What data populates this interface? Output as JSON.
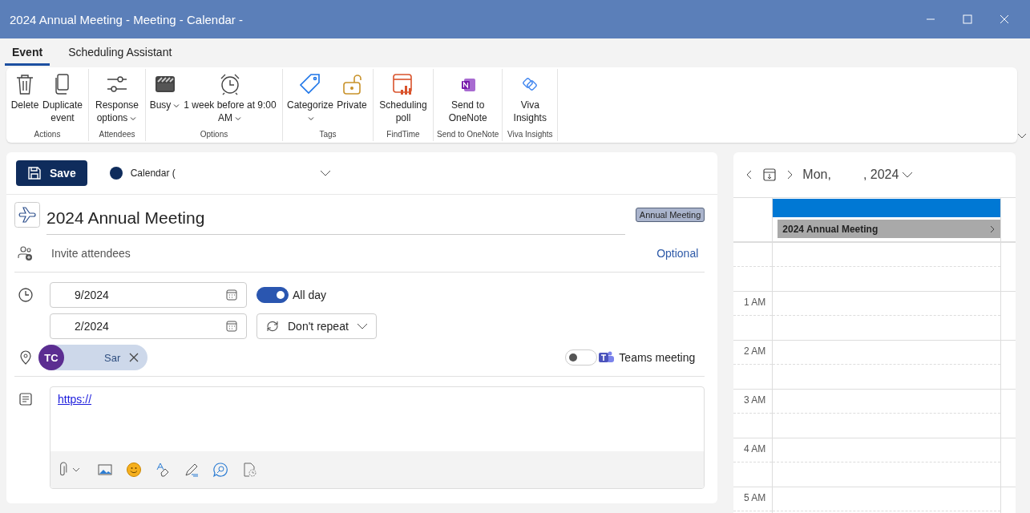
{
  "window": {
    "title": "2024 Annual Meeting - Meeting - Calendar -"
  },
  "tabs": [
    {
      "label": "Event",
      "selected": true
    },
    {
      "label": "Scheduling Assistant",
      "selected": false
    }
  ],
  "ribbon": {
    "groups": [
      {
        "name": "Actions",
        "buttons": [
          {
            "label": "Delete",
            "dropdown": false
          },
          {
            "label": "Duplicate event",
            "dropdown": false
          }
        ]
      },
      {
        "name": "Attendees",
        "buttons": [
          {
            "label": "Response options",
            "dropdown": true
          }
        ]
      },
      {
        "name": "Options",
        "buttons": [
          {
            "label": "Busy",
            "dropdown": true
          },
          {
            "label": "1 week before at 9:00 AM",
            "dropdown": true
          }
        ]
      },
      {
        "name": "Tags",
        "buttons": [
          {
            "label": "Categorize",
            "dropdown": true
          },
          {
            "label": "Private",
            "dropdown": false
          }
        ]
      },
      {
        "name": "FindTime",
        "buttons": [
          {
            "label": "Scheduling poll",
            "dropdown": false
          }
        ]
      },
      {
        "name": "Send to OneNote",
        "buttons": [
          {
            "label": "Send to OneNote",
            "dropdown": false
          }
        ]
      },
      {
        "name": "Viva Insights",
        "buttons": [
          {
            "label": "Viva Insights",
            "dropdown": false
          }
        ]
      }
    ]
  },
  "form": {
    "save": "Save",
    "calendar": "Calendar (",
    "title": "2024 Annual Meeting",
    "category": "Annual Meeting",
    "attendees": {
      "placeholder": "Invite attendees"
    },
    "optional": "Optional",
    "start_date": "9/2024",
    "end_date": "2/2024",
    "all_day": {
      "label": "All day",
      "on": true
    },
    "repeat": "Don't repeat",
    "location": {
      "initials": "TC",
      "name": "Sar"
    },
    "teams": {
      "label": "Teams meeting",
      "on": false
    },
    "body_link": "https://"
  },
  "calendar_panel": {
    "date_start": "Mon,",
    "date_end": ", 2024",
    "event": "2024 Annual Meeting",
    "hours": [
      "1 AM",
      "2 AM",
      "3 AM",
      "4 AM",
      "5 AM"
    ]
  }
}
